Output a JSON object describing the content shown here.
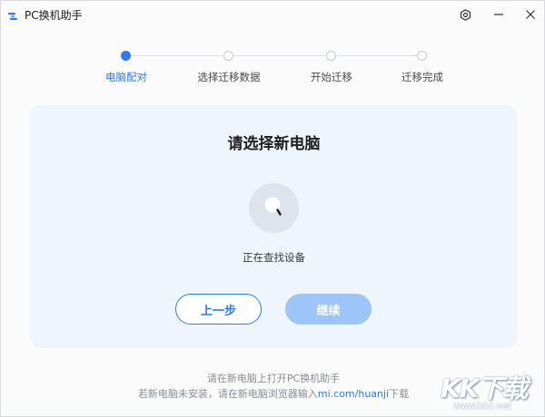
{
  "window": {
    "title": "PC换机助手",
    "accent_color": "#2c7cf6",
    "icons": [
      "settings-icon",
      "minimize-icon",
      "close-icon"
    ]
  },
  "stepper": {
    "steps": [
      {
        "label": "电脑配对",
        "active": true
      },
      {
        "label": "选择迁移数据",
        "active": false
      },
      {
        "label": "开始迁移",
        "active": false
      },
      {
        "label": "迁移完成",
        "active": false
      }
    ]
  },
  "card": {
    "title": "请选择新电脑",
    "status": "正在查找设备",
    "prev_label": "上一步",
    "next_label": "继续"
  },
  "footer": {
    "line1": "请在新电脑上打开PC换机助手",
    "line2_prefix": "若新电脑未安装，请在新电脑浏览器输入",
    "line2_link": "mi.com/huanji",
    "line2_suffix": "下载"
  },
  "watermark": {
    "text": "KK下载",
    "url": "www.kkx.net"
  }
}
